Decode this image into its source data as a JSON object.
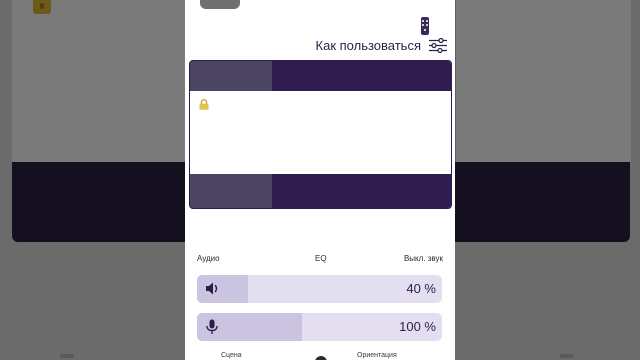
{
  "panel": {
    "how_to_use_label": "Как пользоваться"
  },
  "audio": {
    "header": {
      "audio_label": "Аудио",
      "eq_label": "EQ",
      "mute_label": "Выкл. звук"
    },
    "volume": {
      "value_label": "40 %",
      "level": 0.21
    },
    "microphone": {
      "value_label": "100 %",
      "level": 0.43
    }
  },
  "bottom_row": {
    "left_label": "Сцена",
    "right_label": "Ориентация"
  },
  "icons": {
    "remote": "remote-control-icon",
    "settings": "sliders-icon",
    "lock": "lock-icon",
    "volume": "speaker-icon",
    "microphone": "microphone-icon"
  },
  "colors": {
    "accent": "#2e1d4e",
    "slider_track": "#e3dff0",
    "slider_fill": "#cbc4e0",
    "lock": "#e4c34a"
  }
}
